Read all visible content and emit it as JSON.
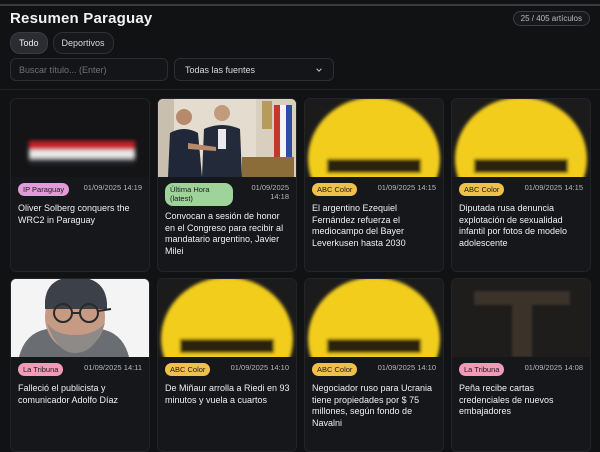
{
  "app": {
    "title": "Resumen Paraguay",
    "count": "25 / 405 artículos"
  },
  "tabs": [
    {
      "label": "Todo",
      "active": true
    },
    {
      "label": "Deportivos",
      "active": false
    }
  ],
  "filters": {
    "search_placeholder": "Buscar título... (Enter)",
    "search_value": "",
    "source_selected": "Todas las fuentes"
  },
  "colors": {
    "ip": "#e29ad9",
    "ultima": "#9ed49a",
    "abc": "#f0c14a",
    "tribuna": "#f19bb6",
    "background": "#111214"
  },
  "cards": [
    {
      "source": "IP Paraguay",
      "date": "01/09/2025 14:19",
      "headline": "Oliver Solberg conquers the WRC2 in Paraguay",
      "image": "flag-banner"
    },
    {
      "source": "Última Hora (latest)",
      "date": "01/09/2025 14:18",
      "headline": "Convocan a sesión de honor en el Congreso para recibir al mandatario argentino, Javier Milei",
      "image": "officials-photo"
    },
    {
      "source": "ABC Color",
      "date": "01/09/2025 14:15",
      "headline": "El argentino Ezequiel Fernández refuerza el mediocampo del Bayer Leverkusen hasta 2030",
      "image": "abc-logo"
    },
    {
      "source": "ABC Color",
      "date": "01/09/2025 14:15",
      "headline": "Diputada rusa denuncia explotación de sexualidad infantil por fotos de modelo adolescente",
      "image": "abc-logo"
    },
    {
      "source": "La Tribuna",
      "date": "01/09/2025 14:11",
      "headline": "Falleció el publicista y comunicador Adolfo Díaz",
      "image": "portrait-photo"
    },
    {
      "source": "ABC Color",
      "date": "01/09/2025 14:10",
      "headline": "De Miñaur arrolla a Riedi en 93 minutos y vuela a cuartos",
      "image": "abc-logo"
    },
    {
      "source": "ABC Color",
      "date": "01/09/2025 14:10",
      "headline": "Negociador ruso para Ucrania tiene propiedades por $ 75 millones, según fondo de Navalni",
      "image": "abc-logo"
    },
    {
      "source": "La Tribuna",
      "date": "01/09/2025 14:08",
      "headline": "Peña recibe cartas credenciales de nuevos embajadores",
      "image": "tribuna-logo"
    }
  ]
}
